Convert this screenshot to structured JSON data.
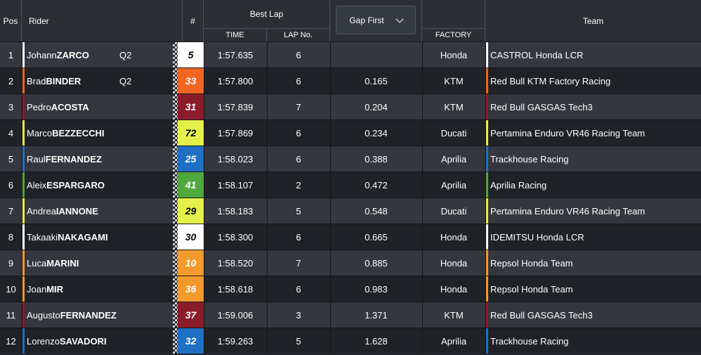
{
  "headers": {
    "pos": "Pos",
    "rider": "Rider",
    "number": "#",
    "best_lap": "Best Lap",
    "time": "TIME",
    "lap_no": "LAP No.",
    "gap_first": "Gap First",
    "factory": "FACTORY",
    "team": "Team"
  },
  "rows": [
    {
      "pos": "1",
      "first": "Johann",
      "last": "ZARCO",
      "tag": "Q2",
      "number": "5",
      "num_bg": "#ffffff",
      "num_fg": "#000000",
      "time": "1:57.635",
      "lap": "6",
      "gap": "",
      "factory": "Honda",
      "team": "CASTROL Honda LCR",
      "team_color": "#ffffff"
    },
    {
      "pos": "2",
      "first": "Brad",
      "last": "BINDER",
      "tag": "Q2",
      "number": "33",
      "num_bg": "#f26522",
      "num_fg": "#ffffff",
      "time": "1:57.800",
      "lap": "6",
      "gap": "0.165",
      "factory": "KTM",
      "team": "Red Bull KTM Factory Racing",
      "team_color": "#f26522"
    },
    {
      "pos": "3",
      "first": "Pedro",
      "last": "ACOSTA",
      "tag": "",
      "number": "31",
      "num_bg": "#8b1c2b",
      "num_fg": "#ffffff",
      "time": "1:57.839",
      "lap": "7",
      "gap": "0.204",
      "factory": "KTM",
      "team": "Red Bull GASGAS Tech3",
      "team_color": "#8b1c2b"
    },
    {
      "pos": "4",
      "first": "Marco",
      "last": "BEZZECCHI",
      "tag": "",
      "number": "72",
      "num_bg": "#e6f04a",
      "num_fg": "#000000",
      "time": "1:57.869",
      "lap": "6",
      "gap": "0.234",
      "factory": "Ducati",
      "team": "Pertamina Enduro VR46 Racing Team",
      "team_color": "#e6f04a"
    },
    {
      "pos": "5",
      "first": "Raul",
      "last": "FERNANDEZ",
      "tag": "",
      "number": "25",
      "num_bg": "#1f6fc5",
      "num_fg": "#ffffff",
      "time": "1:58.023",
      "lap": "6",
      "gap": "0.388",
      "factory": "Aprilia",
      "team": "Trackhouse Racing",
      "team_color": "#1f6fc5"
    },
    {
      "pos": "6",
      "first": "Aleix",
      "last": "ESPARGARO",
      "tag": "",
      "number": "41",
      "num_bg": "#4fa83c",
      "num_fg": "#ffffff",
      "time": "1:58.107",
      "lap": "2",
      "gap": "0.472",
      "factory": "Aprilia",
      "team": "Aprilia Racing",
      "team_color": "#4fa83c"
    },
    {
      "pos": "7",
      "first": "Andrea",
      "last": "IANNONE",
      "tag": "",
      "number": "29",
      "num_bg": "#e6f04a",
      "num_fg": "#000000",
      "time": "1:58.183",
      "lap": "5",
      "gap": "0.548",
      "factory": "Ducati",
      "team": "Pertamina Enduro VR46 Racing Team",
      "team_color": "#e6f04a"
    },
    {
      "pos": "8",
      "first": "Takaaki",
      "last": "NAKAGAMI",
      "tag": "",
      "number": "30",
      "num_bg": "#ffffff",
      "num_fg": "#000000",
      "time": "1:58.300",
      "lap": "6",
      "gap": "0.665",
      "factory": "Honda",
      "team": "IDEMITSU Honda LCR",
      "team_color": "#ffffff"
    },
    {
      "pos": "9",
      "first": "Luca",
      "last": "MARINI",
      "tag": "",
      "number": "10",
      "num_bg": "#f39a2e",
      "num_fg": "#ffffff",
      "time": "1:58.520",
      "lap": "7",
      "gap": "0.885",
      "factory": "Honda",
      "team": "Repsol Honda Team",
      "team_color": "#f39a2e"
    },
    {
      "pos": "10",
      "first": "Joan",
      "last": "MIR",
      "tag": "",
      "number": "36",
      "num_bg": "#f39a2e",
      "num_fg": "#ffffff",
      "time": "1:58.618",
      "lap": "6",
      "gap": "0.983",
      "factory": "Honda",
      "team": "Repsol Honda Team",
      "team_color": "#f39a2e"
    },
    {
      "pos": "11",
      "first": "Augusto",
      "last": "FERNANDEZ",
      "tag": "",
      "number": "37",
      "num_bg": "#8b1c2b",
      "num_fg": "#ffffff",
      "time": "1:59.006",
      "lap": "3",
      "gap": "1.371",
      "factory": "KTM",
      "team": "Red Bull GASGAS Tech3",
      "team_color": "#8b1c2b"
    },
    {
      "pos": "12",
      "first": "Lorenzo",
      "last": "SAVADORI",
      "tag": "",
      "number": "32",
      "num_bg": "#1f6fc5",
      "num_fg": "#ffffff",
      "time": "1:59.263",
      "lap": "5",
      "gap": "1.628",
      "factory": "Aprilia",
      "team": "Trackhouse Racing",
      "team_color": "#1f6fc5"
    }
  ]
}
